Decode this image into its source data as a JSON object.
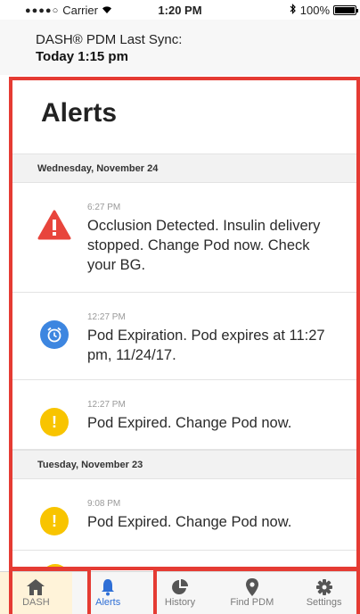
{
  "status_bar": {
    "carrier": "Carrier",
    "time": "1:20 PM",
    "battery": "100%"
  },
  "sync": {
    "label": "DASH® PDM Last Sync:",
    "value": "Today 1:15 pm"
  },
  "page_title": "Alerts",
  "sections": [
    {
      "date": "Wednesday, November 24",
      "alerts": [
        {
          "time": "6:27 PM",
          "message": "Occlusion Detected. Insulin delivery stopped. Change Pod now. Check your BG.",
          "icon": "warning-triangle-icon"
        },
        {
          "time": "12:27 PM",
          "message": "Pod Expiration. Pod expires at 11:27 pm, 11/24/17.",
          "icon": "alarm-clock-icon"
        },
        {
          "time": "12:27 PM",
          "message": "Pod Expired. Change Pod now.",
          "icon": "exclamation-circle-icon"
        }
      ]
    },
    {
      "date": "Tuesday, November 23",
      "alerts": [
        {
          "time": "9:08 PM",
          "message": "Pod Expired. Change Pod now.",
          "icon": "exclamation-circle-icon"
        }
      ]
    }
  ],
  "tabs": [
    {
      "label": "DASH",
      "icon": "home-icon"
    },
    {
      "label": "Alerts",
      "icon": "bell-icon",
      "active": true
    },
    {
      "label": "History",
      "icon": "pie-chart-icon"
    },
    {
      "label": "Find PDM",
      "icon": "location-pin-icon"
    },
    {
      "label": "Settings",
      "icon": "gear-icon"
    }
  ],
  "colors": {
    "active_tab": "#2f6fd6",
    "alert_red": "#e8453c",
    "alert_yellow": "#f8c400",
    "alert_blue": "#3d86e0",
    "highlight_frame": "#e53b33"
  }
}
